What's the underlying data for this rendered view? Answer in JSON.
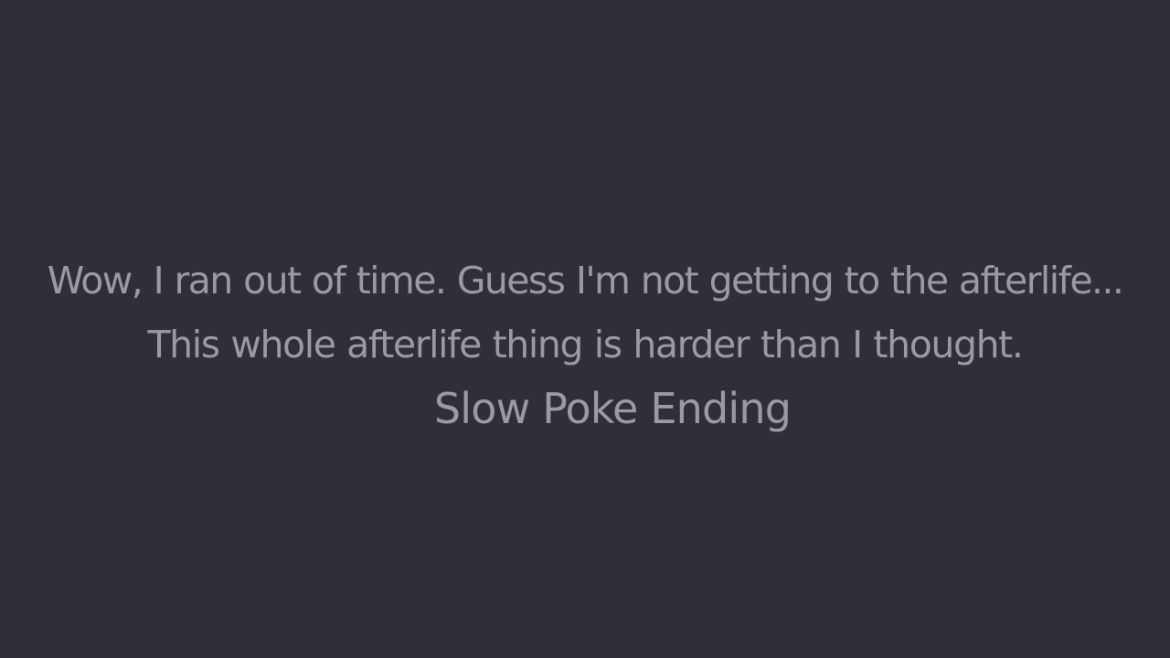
{
  "ending": {
    "line1": "Wow, I ran out of time. Guess I'm not getting to the afterlife...",
    "line2": "This whole afterlife thing is harder than I thought.",
    "title": "Slow Poke Ending"
  },
  "colors": {
    "background": "#312d39",
    "text": "#9d99a1"
  }
}
